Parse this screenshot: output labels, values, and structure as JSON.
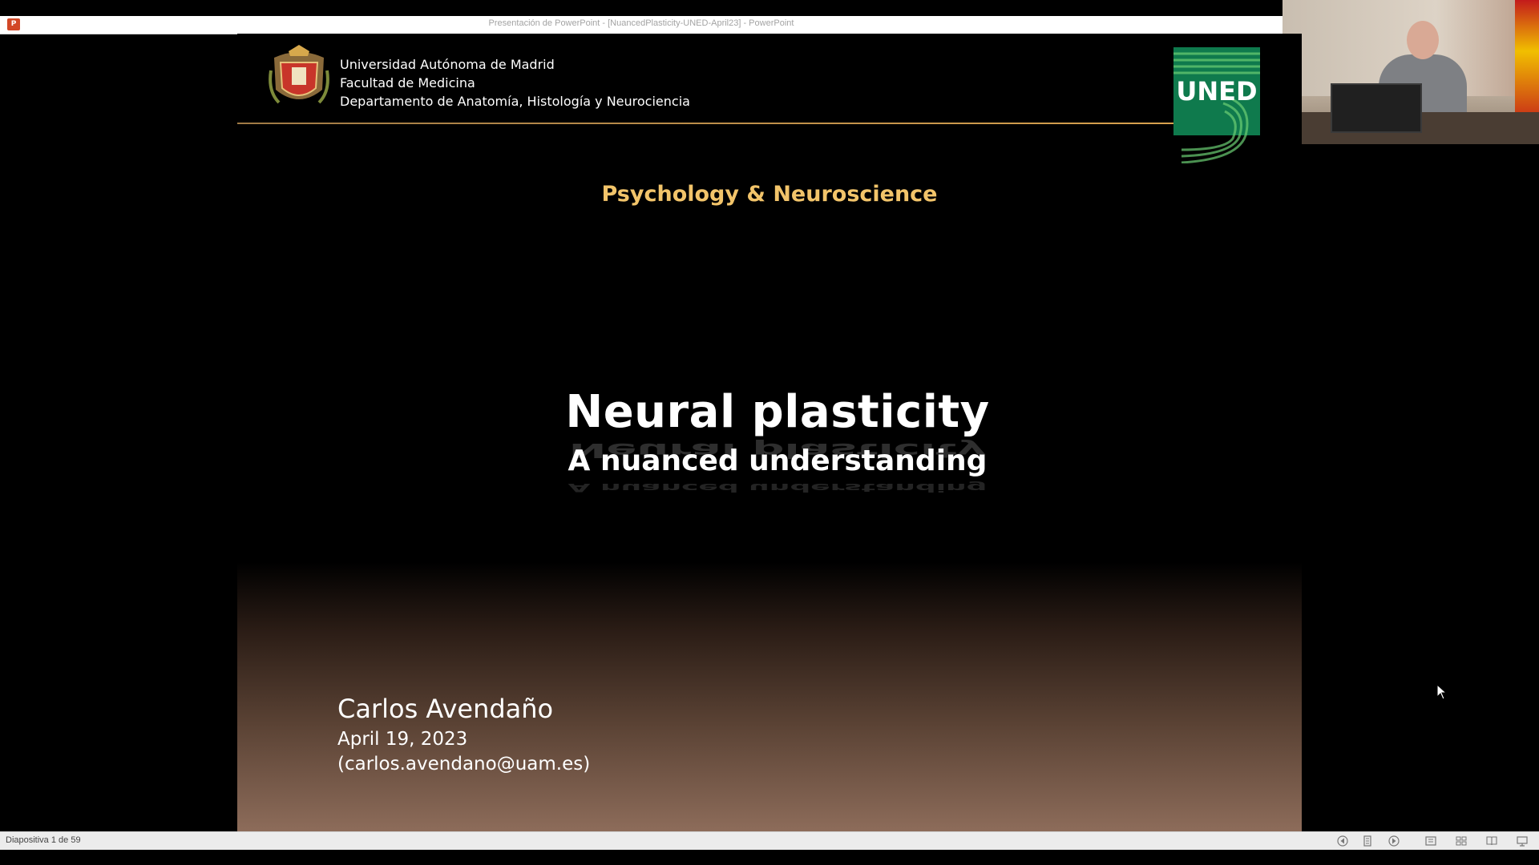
{
  "window": {
    "title": "Presentación de PowerPoint - [NuancedPlasticity-UNED-April23] - PowerPoint",
    "app_icon": "powerpoint-icon",
    "app_icon_glyph": "P"
  },
  "slide": {
    "institution": {
      "line1": "Universidad Autónoma de Madrid",
      "line2": "Facultad de Medicina",
      "line3": "Departamento de Anatomía, Histología y Neurociencia"
    },
    "crest": "university-crest-icon",
    "partner_logo": {
      "text": "UNED",
      "color": "#0f7a4d"
    },
    "course_title": "Psychology & Neuroscience",
    "title": "Neural plasticity",
    "subtitle": "A nuanced understanding",
    "author": "Carlos Avendaño",
    "date": "April 19, 2023",
    "email": "(carlos.avendano@uam.es)",
    "colors": {
      "accent": "#f2c46a",
      "background_bottom": "#8d6c5a"
    }
  },
  "statusbar": {
    "slide_counter": "Diapositiva 1 de 59",
    "buttons": [
      "previous-icon",
      "notes-icon",
      "next-icon",
      "normal-view-icon",
      "slide-sorter-icon",
      "reading-view-icon",
      "slideshow-icon"
    ]
  }
}
